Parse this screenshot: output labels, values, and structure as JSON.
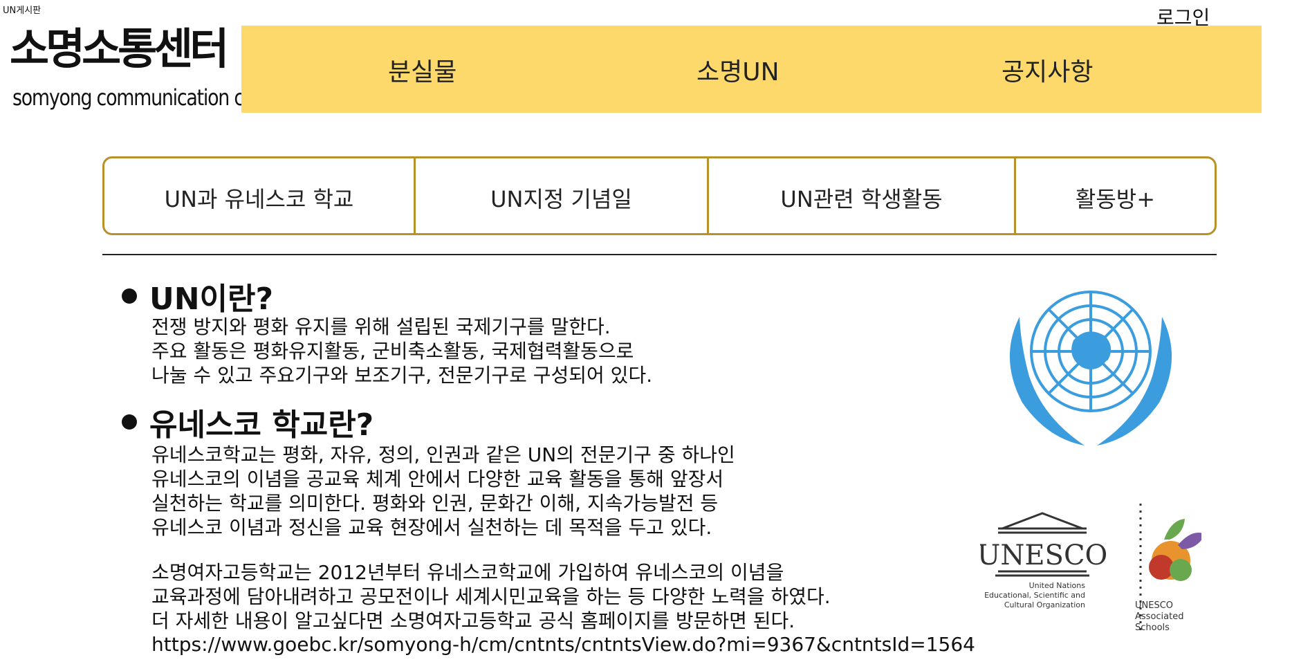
{
  "header": {
    "doc_title": "UN게시판",
    "logo_main": "소명소통센터",
    "logo_sub": "somyong communication center",
    "login": "로그인"
  },
  "top_nav": [
    "분실물",
    "소명UN",
    "공지사항"
  ],
  "tabs": [
    "UN과 유네스코 학교",
    "UN지정 기념일",
    "UN관련 학생활동",
    "활동방+"
  ],
  "sections": {
    "un": {
      "heading": "UN이란?",
      "text": "전쟁 방지와 평화 유지를 위해 설립된 국제기구를 말한다.\n주요 활동은 평화유지활동, 군비축소활동, 국제협력활동으로\n나눌 수 있고 주요기구와 보조기구, 전문기구로 구성되어 있다."
    },
    "unesco": {
      "heading": "유네스코 학교란?",
      "text": "유네스코학교는 평화, 자유, 정의, 인권과 같은 UN의 전문기구 중 하나인\n유네스코의 이념을 공교육 체계 안에서 다양한 교육 활동을 통해 앞장서\n실천하는 학교를 의미한다. 평화와 인권, 문화간 이해, 지속가능발전 등\n유네스코 이념과 정신을 교육 현장에서 실천하는 데 목적을 두고 있다.",
      "somyong_text": "소명여자고등학교는 2012년부터 유네스코학교에 가입하여 유네스코의 이념을\n교육과정에 담아내려하고 공모전이나 세계시민교육을 하는 등 다양한 노력을 하였다.\n더 자세한 내용이 알고싶다면 소명여자고등학교 공식 홈페이지를 방문하면 된다.",
      "url": "https://www.goebc.kr/somyong-h/cm/cntnts/cntntsView.do?mi=9367&cntntsId=1564"
    }
  },
  "images": {
    "unesco_name": "UNESCO",
    "unesco_full": "United Nations\nEducational, Scientific and\nCultural Organization",
    "asp_name": "UNESCO\nAssociated\nSchools"
  },
  "colors": {
    "nav_bg": "#fdd86a",
    "tab_border": "#b8912b",
    "un_blue": "#3b9ddd"
  }
}
